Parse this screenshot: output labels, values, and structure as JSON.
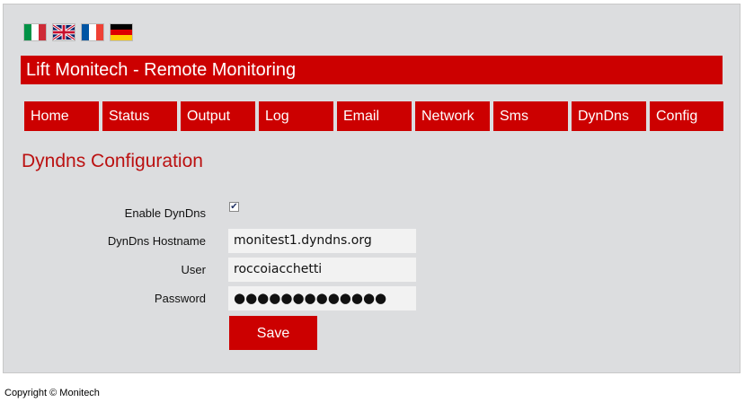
{
  "languages": [
    {
      "name": "italian-flag-icon",
      "colors": [
        "#009246",
        "#ffffff",
        "#ce2b37"
      ]
    },
    {
      "name": "uk-flag-icon",
      "colors": [
        "#012169",
        "#ffffff",
        "#c8102e"
      ]
    },
    {
      "name": "french-flag-icon",
      "colors": [
        "#0055a4",
        "#ffffff",
        "#ef4135"
      ]
    },
    {
      "name": "german-flag-icon",
      "colors": [
        "#000000",
        "#dd0000",
        "#ffce00"
      ]
    }
  ],
  "header": {
    "title": "Lift Monitech - Remote Monitoring"
  },
  "nav": {
    "items": [
      {
        "label": "Home"
      },
      {
        "label": "Status"
      },
      {
        "label": "Output"
      },
      {
        "label": "Log"
      },
      {
        "label": "Email"
      },
      {
        "label": "Network"
      },
      {
        "label": "Sms"
      },
      {
        "label": "DynDns"
      },
      {
        "label": "Config"
      }
    ]
  },
  "page": {
    "heading": "Dyndns Configuration"
  },
  "form": {
    "enable_label": "Enable DynDns",
    "enable_checked": true,
    "check_glyph": "✔",
    "hostname_label": "DynDns Hostname",
    "hostname_value": "monitest1.dyndns.org",
    "user_label": "User",
    "user_value": "roccoiacchetti",
    "password_label": "Password",
    "password_value": "●●●●●●●●●●●●●",
    "save_label": "Save"
  },
  "footer": {
    "copyright": "Copyright © Monitech"
  },
  "colors": {
    "accent": "#cc0000",
    "heading": "#bb1111",
    "panel": "#dcdddf"
  }
}
